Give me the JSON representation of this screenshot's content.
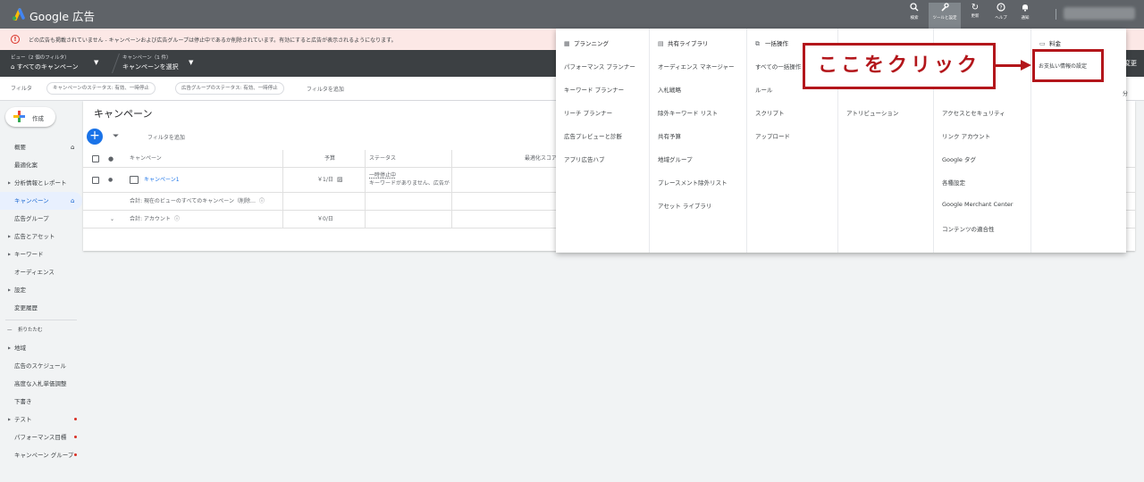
{
  "app": {
    "title": "Google 広告"
  },
  "topbar": {
    "buttons": [
      {
        "icon": "search-icon",
        "glyph": "⚲",
        "label": "検索"
      },
      {
        "icon": "wrench-icon",
        "glyph": "✎",
        "label": "ツールと設定"
      },
      {
        "icon": "refresh-icon",
        "glyph": "↻",
        "label": "更新"
      },
      {
        "icon": "help-icon",
        "glyph": "?",
        "label": "ヘルプ"
      },
      {
        "icon": "bell-icon",
        "glyph": "♫",
        "label": "通知"
      }
    ]
  },
  "alert": {
    "text": "どの広告も掲載されていません - キャンペーンおよび広告グループは停止中であるか削除されています。有効にすると広告が表示されるようになります。"
  },
  "viewbar": {
    "filter_small": "ビュー（2 個のフィルタ）",
    "filter_main": "すべてのキャンペーン",
    "campaign_small": "キャンペーン（1 件）",
    "campaign_main": "キャンペーンを選択",
    "right": "変更"
  },
  "filterbar": {
    "label": "フィルタ",
    "chips": [
      "キャンペーンのステータス: 有効、一時停止",
      "広告グループのステータス: 有効、一時停止"
    ],
    "add": "フィルタを追加",
    "right": "分"
  },
  "sidebar": {
    "create": "作成",
    "items": [
      {
        "label": "概要",
        "home": true
      },
      {
        "label": "最適化案"
      },
      {
        "label": "分析情報とレポート",
        "arrow": true
      },
      {
        "label": "キャンペーン",
        "selected": true,
        "home": true
      },
      {
        "label": "広告グループ"
      },
      {
        "label": "広告とアセット",
        "arrow": true
      },
      {
        "label": "キーワード",
        "arrow": true
      },
      {
        "label": "オーディエンス"
      },
      {
        "label": "設定",
        "arrow": true
      },
      {
        "label": "変更履歴"
      }
    ],
    "collapse": "折りたたむ",
    "items2": [
      {
        "label": "地域",
        "arrow": true
      },
      {
        "label": "広告のスケジュール"
      },
      {
        "label": "高度な入札単価調整"
      },
      {
        "label": "下書き"
      },
      {
        "label": "テスト",
        "arrow": true,
        "dot": true
      },
      {
        "label": "パフォーマンス目標",
        "dot": true
      },
      {
        "label": "キャンペーン グループ",
        "dot": true
      }
    ]
  },
  "main": {
    "title": "キャンペーン",
    "filter_add": "フィルタを追加",
    "headers": {
      "campaign": "キャンペーン",
      "budget": "予算",
      "status": "ステータス",
      "score": "最適化スコア"
    },
    "rows": [
      {
        "name": "キャンペーン1",
        "budget": "￥1/日",
        "status1": "一時停止中",
        "status2": "キーワードがありません、広告が"
      },
      {
        "name": "合計: 現在のビューのすべてのキャンペーン（削除…",
        "budget": "",
        "status1": "",
        "status2": ""
      },
      {
        "name": "合計: アカウント",
        "budget": "￥0/日",
        "status1": "",
        "status2": ""
      }
    ]
  },
  "menu": {
    "columns": [
      {
        "head": "プランニング",
        "icon": "calendar-icon",
        "glyph": "▦",
        "items": [
          "パフォーマンス プランナー",
          "キーワード プランナー",
          "リーチ プランナー",
          "広告プレビューと診断",
          "アプリ広告ハブ"
        ]
      },
      {
        "head": "共有ライブラリ",
        "icon": "library-icon",
        "glyph": "▤",
        "items": [
          "オーディエンス マネージャー",
          "入札戦略",
          "除外キーワード リスト",
          "共有予算",
          "地域グループ",
          "プレースメント除外リスト",
          "アセット ライブラリ"
        ]
      },
      {
        "head": "一括操作",
        "icon": "copy-icon",
        "glyph": "⧉",
        "items": [
          "すべての一括操作",
          "ルール",
          "スクリプト",
          "アップロード"
        ]
      },
      {
        "head": "",
        "icon": "",
        "glyph": "",
        "items": [
          "",
          "アトリビューション"
        ]
      },
      {
        "head": "",
        "icon": "",
        "glyph": "",
        "items": [
          "",
          "アクセスとセキュリティ",
          "リンク アカウント",
          "Google タグ",
          "各種設定",
          "Google Merchant Center",
          "コンテンツの適合性"
        ]
      },
      {
        "head": "料金",
        "icon": "card-icon",
        "glyph": "▭",
        "items": [
          "お支払い情報の設定"
        ]
      }
    ]
  },
  "callout": {
    "text": "ここをクリック"
  },
  "colors": {
    "accent": "#1a73e8",
    "callout": "#b3161b",
    "topbar": "#5f6368"
  }
}
